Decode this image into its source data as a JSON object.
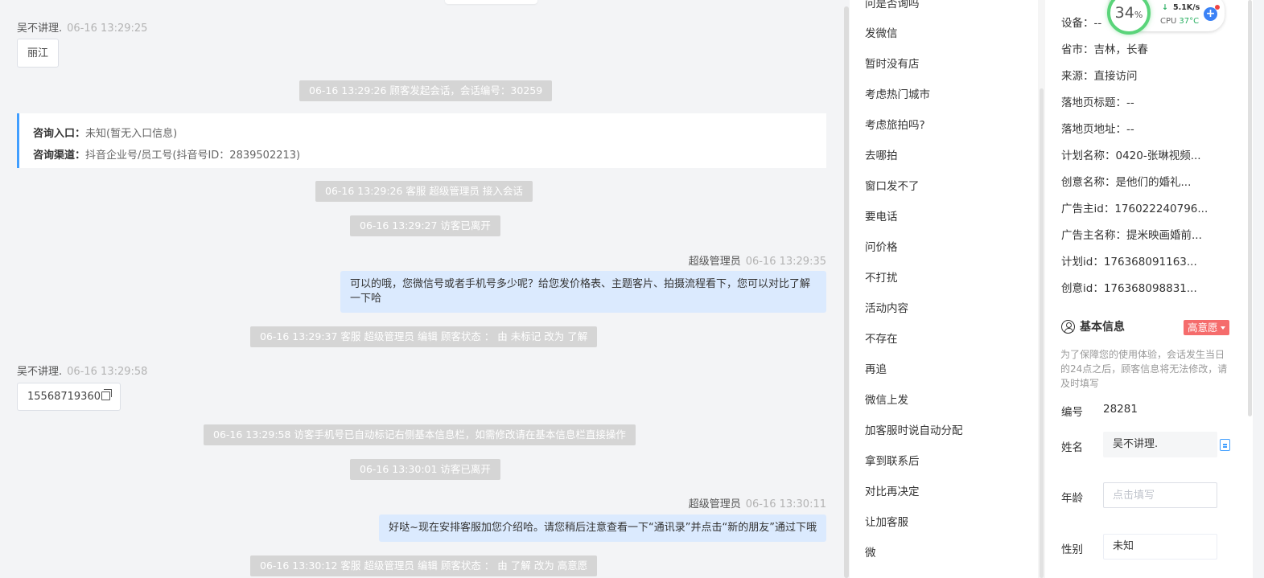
{
  "chat": {
    "visitor_name": "吴不讲理.",
    "agent_name": "超级管理员",
    "messages": {
      "m1_time": "06-16 13:29:25",
      "m1_text": "丽江",
      "sys1": "06-16 13:29:26 顾客发起会话，会话编号：30259",
      "entry_label": "咨询入口：",
      "entry_value": "未知(暂无入口信息)",
      "channel_label": "咨询渠道：",
      "channel_value": "抖音企业号/员工号(抖音号ID：2839502213)",
      "sys2": "06-16 13:29:26 客服 超级管理员 接入会话",
      "sys3": "06-16 13:29:27 访客已离开",
      "m2_time": "06-16 13:29:35",
      "m2_text": "可以的哦，您微信号或者手机号多少呢？给您发价格表、主题客片、拍摄流程看下，您可以对比了解一下哈",
      "sys4": "06-16 13:29:37 客服 超级管理员 编辑 顾客状态 ： 由 未标记 改为 了解",
      "m3_time": "06-16 13:29:58",
      "m3_text": "15568719360",
      "sys5": "06-16 13:29:58 访客手机号已自动标记右侧基本信息栏，如需修改请在基本信息栏直接操作",
      "sys6": "06-16 13:30:01 访客已离开",
      "m4_time": "06-16 13:30:11",
      "m4_text": "好哒~现在安排客服加您介绍哈。请您稍后注意查看一下“通讯录”并点击“新的朋友”通过下哦",
      "sys7": "06-16 13:30:12 客服 超级管理员 编辑 顾客状态 ： 由 了解 改为 高意愿"
    }
  },
  "quick_replies": [
    "问是否询吗",
    "发微信",
    "暂时没有店",
    "考虑热门城市",
    "考虑旅拍吗?",
    "去哪拍",
    "窗口发不了",
    "要电话",
    "问价格",
    "不打扰",
    "活动内容",
    "不存在",
    "再追",
    "微信上发",
    "加客服时说自动分配",
    "拿到联系后",
    "对比再决定",
    "让加客服",
    "微"
  ],
  "info": {
    "device": "设备：--",
    "province": "省市：吉林，长春",
    "source": "来源：直接访问",
    "landing_title": "落地页标题：--",
    "landing_url": "落地页地址：--",
    "plan_name": "计划名称：0420-张琳视频...",
    "creative_name": "创意名称：是他们的婚礼...",
    "advertiser_id": "广告主id：176022240796...",
    "advertiser_name": "广告主名称：提米映画婚前...",
    "plan_id": "计划id：176368091163...",
    "creative_id": "创意id：176368098831...",
    "section_title": "基本信息",
    "intent_badge": "高意愿",
    "notice": "为了保障您的使用体验，会话发生当日的24点之后，顾客信息将无法修改，请及时填写",
    "id_label": "编号",
    "id_value": "28281",
    "name_label": "姓名",
    "name_value": "吴不讲理.",
    "age_label": "年龄",
    "age_placeholder": "点击填写",
    "gender_label": "性别",
    "gender_value": "未知"
  },
  "monitor": {
    "cpu_percent": "34",
    "percent_sign": "%",
    "net_speed": "5.1K/s",
    "cpu_label": "CPU",
    "cpu_temp": "37°C"
  },
  "colors": {
    "accent": "#409eff",
    "agent_bubble": "#dbeafe",
    "system_notice": "#d5d5d5",
    "intent_badge": "#f56c6c",
    "gauge": "#5ad47a"
  }
}
